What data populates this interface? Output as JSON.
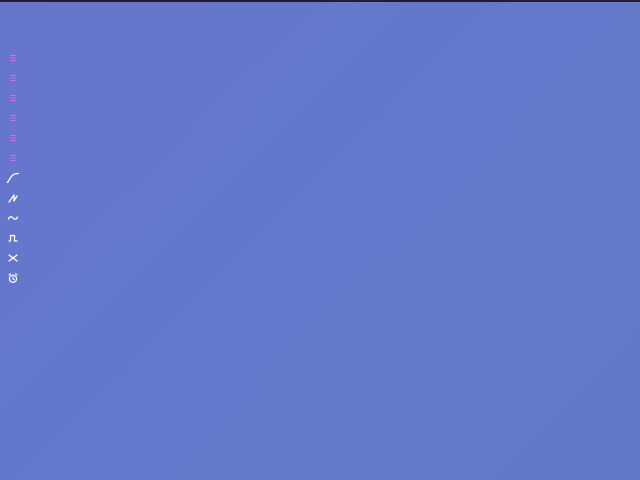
{
  "colors": {
    "background": "#6479cb",
    "top_bar": "#1d1f2c",
    "menu_icon": "#d868ee",
    "tool_icon": "#ffffff"
  },
  "toolbar": {
    "items": [
      {
        "icon": "menu-lines-icon"
      },
      {
        "icon": "menu-lines-icon"
      },
      {
        "icon": "menu-lines-icon"
      },
      {
        "icon": "menu-lines-icon"
      },
      {
        "icon": "menu-lines-icon"
      },
      {
        "icon": "menu-lines-icon"
      },
      {
        "icon": "ramp-curve-icon"
      },
      {
        "icon": "sawtooth-icon"
      },
      {
        "icon": "sine-wave-icon"
      },
      {
        "icon": "square-pulse-icon"
      },
      {
        "icon": "random-cross-icon"
      },
      {
        "icon": "alarm-clock-icon"
      }
    ]
  }
}
